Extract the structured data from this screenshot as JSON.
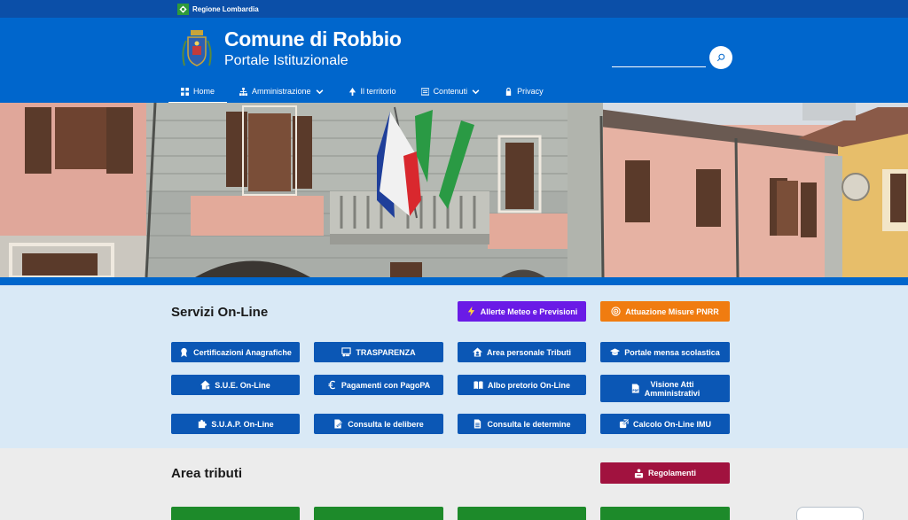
{
  "topbar": {
    "region_label": "Regione Lombardia"
  },
  "header": {
    "title": "Comune di Robbio",
    "subtitle": "Portale Istituzionale",
    "search_placeholder": ""
  },
  "nav": [
    {
      "label": "Home",
      "icon": "grid-icon",
      "active": true
    },
    {
      "label": "Amministrazione",
      "icon": "org-chart-icon",
      "dropdown": true
    },
    {
      "label": "Il territorio",
      "icon": "tree-icon"
    },
    {
      "label": "Contenuti",
      "icon": "list-icon",
      "dropdown": true
    },
    {
      "label": "Privacy",
      "icon": "lock-icon"
    }
  ],
  "services": {
    "title": "Servizi On-Line",
    "highlight_buttons": [
      {
        "label": "Allerte Meteo e Previsioni",
        "icon": "lightning-icon",
        "color": "#6a1be6"
      },
      {
        "label": "Attuazione Misure PNRR",
        "icon": "target-icon",
        "color": "#f07c10"
      }
    ],
    "buttons": [
      {
        "label": "Certificazioni Anagrafiche",
        "icon": "certificate-icon"
      },
      {
        "label": "TRASPARENZA",
        "icon": "presentation-icon"
      },
      {
        "label": "Area personale Tributi",
        "icon": "house-user-icon"
      },
      {
        "label": "Portale mensa scolastica",
        "icon": "graduation-cap-icon"
      },
      {
        "label": "S.U.E. On-Line",
        "icon": "house-icon"
      },
      {
        "label": "Pagamenti con PagoPA",
        "icon": "euro-icon"
      },
      {
        "label": "Albo pretorio On-Line",
        "icon": "book-icon"
      },
      {
        "label_line1": "Visione Atti",
        "label_line2": "Amministrativi",
        "icon": "pdf-icon"
      },
      {
        "label": "S.U.A.P. On-Line",
        "icon": "puzzle-icon"
      },
      {
        "label": "Consulta le delibere",
        "icon": "file-sign-icon"
      },
      {
        "label": "Consulta le determine",
        "icon": "file-text-icon"
      },
      {
        "label": "Calcolo On-Line IMU",
        "icon": "external-link-icon"
      }
    ],
    "colors": {
      "button": "#0b57b5",
      "section_bg": "#d9e9f6"
    }
  },
  "tributi": {
    "title": "Area tributi",
    "regolamenti_label": "Regolamenti",
    "regolamenti_color": "#a1123f",
    "green_color": "#1d8a2a"
  }
}
